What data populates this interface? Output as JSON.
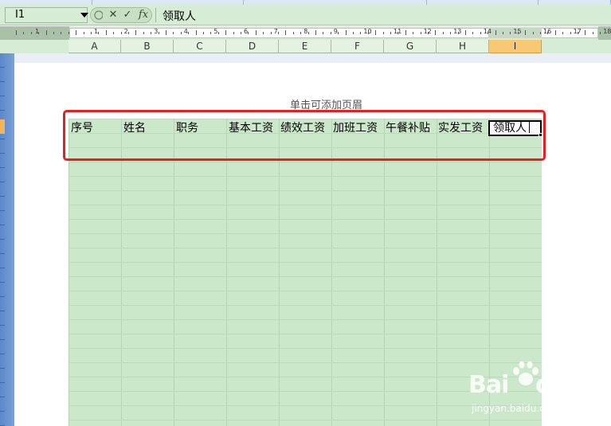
{
  "formula_bar": {
    "name_box": "I1",
    "cancel_glyph": "✕",
    "enter_glyph": "✓",
    "function_glyph": "fx",
    "content": "领取人"
  },
  "ruler": {
    "numbers": [
      "1",
      "1",
      "2",
      "3",
      "4",
      "5",
      "6",
      "7",
      "8",
      "9",
      "10",
      "11",
      "12",
      "13",
      "14",
      "15",
      "16",
      "17",
      "18"
    ]
  },
  "columns": [
    "A",
    "B",
    "C",
    "D",
    "E",
    "F",
    "G",
    "H",
    "I"
  ],
  "active_column": "I",
  "page": {
    "header_hint": "单击可添加页眉"
  },
  "header_row": [
    "序号",
    "姓名",
    "职务",
    "基本工资",
    "绩效工资",
    "加班工资",
    "午餐补贴",
    "实发工资",
    "领取人"
  ],
  "watermark": {
    "brand_left": "Bai",
    "brand_right": "du",
    "brand_cn": "经验",
    "url": "jingyan.baidu.com"
  },
  "colors": {
    "annotation": "#e5201d",
    "sheet_green": "#cce8cb",
    "active_header": "#f8c873",
    "frame_blue": "#5b87c9"
  }
}
